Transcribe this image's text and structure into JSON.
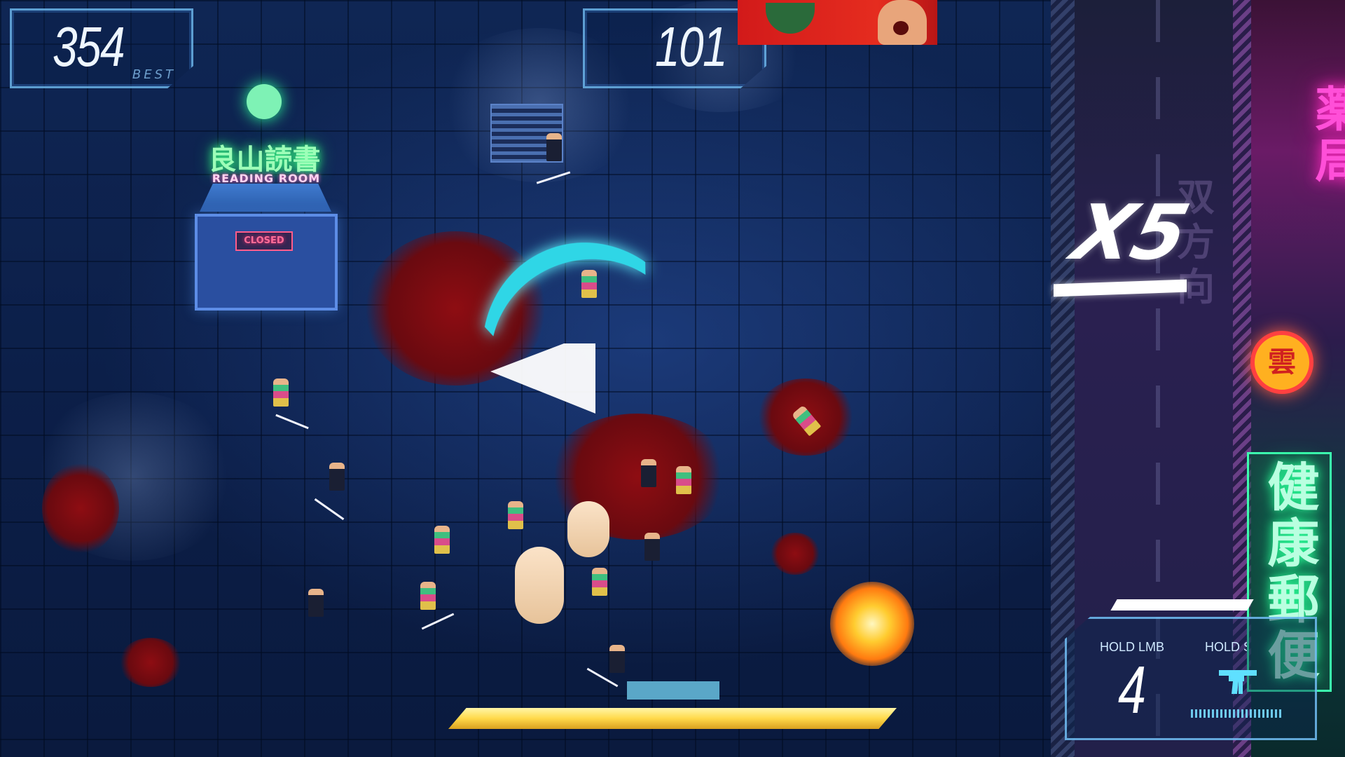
{
  "hud": {
    "best_score": "354",
    "best_label": "BEST",
    "current_score": "101",
    "combo_multiplier": "X5",
    "weapon": {
      "primary_hint": "HOLD LMB",
      "secondary_hint": "HOLD SPACE",
      "ammo": "4",
      "secondary_icon": "smg-icon"
    },
    "dash_meter": 1.0
  },
  "world": {
    "shop_sign": "良山読書",
    "shop_subsign": "READING ROOM",
    "shop_status": "CLOSED",
    "street_marking": "双方向",
    "pink_sign": "薬局",
    "round_sign": "雲",
    "green_sign": "健康郵便"
  },
  "colors": {
    "hud_cyan": "#78c8ff",
    "slash_cyan": "#2fd6e6",
    "blood": "#8e0d12",
    "dash_yellow": "#ffd94a",
    "neon_pink": "#ff4fd8",
    "neon_green": "#3dffb0"
  }
}
